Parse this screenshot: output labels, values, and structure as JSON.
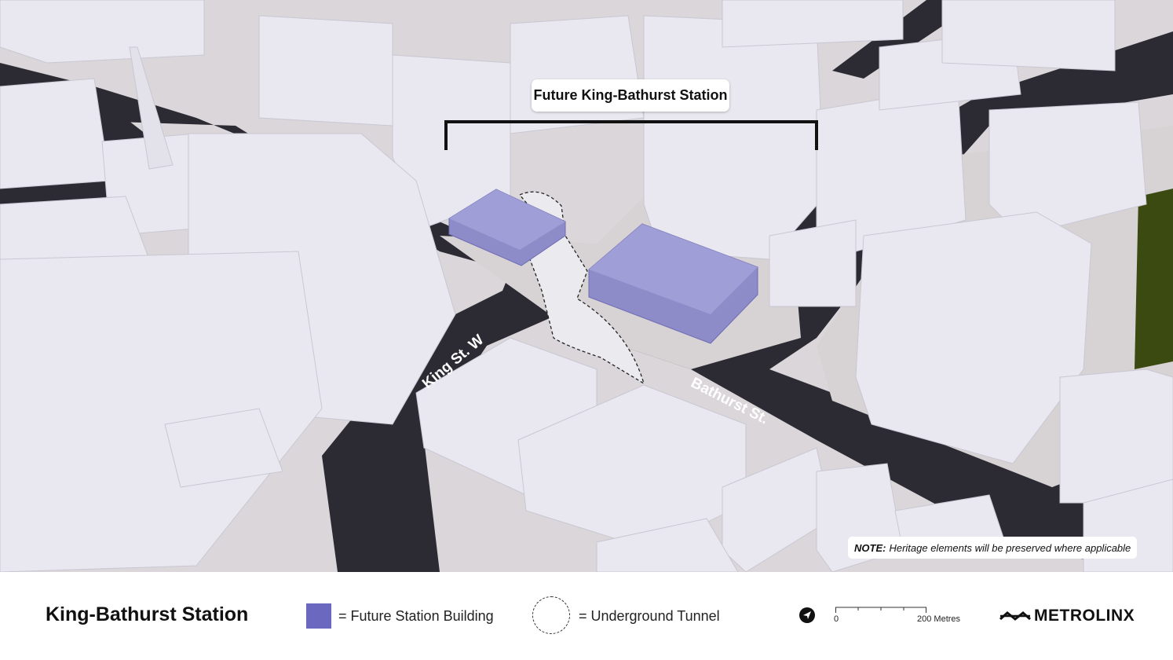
{
  "map": {
    "callout_title": "Future King-Bathurst Station",
    "streets": {
      "king": "King St. W",
      "bathurst": "Bathurst St."
    },
    "note": {
      "label": "NOTE:",
      "text": "Heritage elements will be preserved where applicable"
    }
  },
  "legend": {
    "title": "King-Bathurst Station",
    "station_building": "= Future Station Building",
    "tunnel": "= Underground Tunnel",
    "scale": {
      "start": "0",
      "end": "200 Metres"
    },
    "brand": "METROLINX"
  },
  "colors": {
    "station_building": "#6b68bf",
    "road": "#2c2b33",
    "building": "#e9e8f0",
    "park": "#3b4a10"
  },
  "icons": {
    "north": "north-arrow-icon",
    "logo": "metrolinx-wave-icon"
  }
}
